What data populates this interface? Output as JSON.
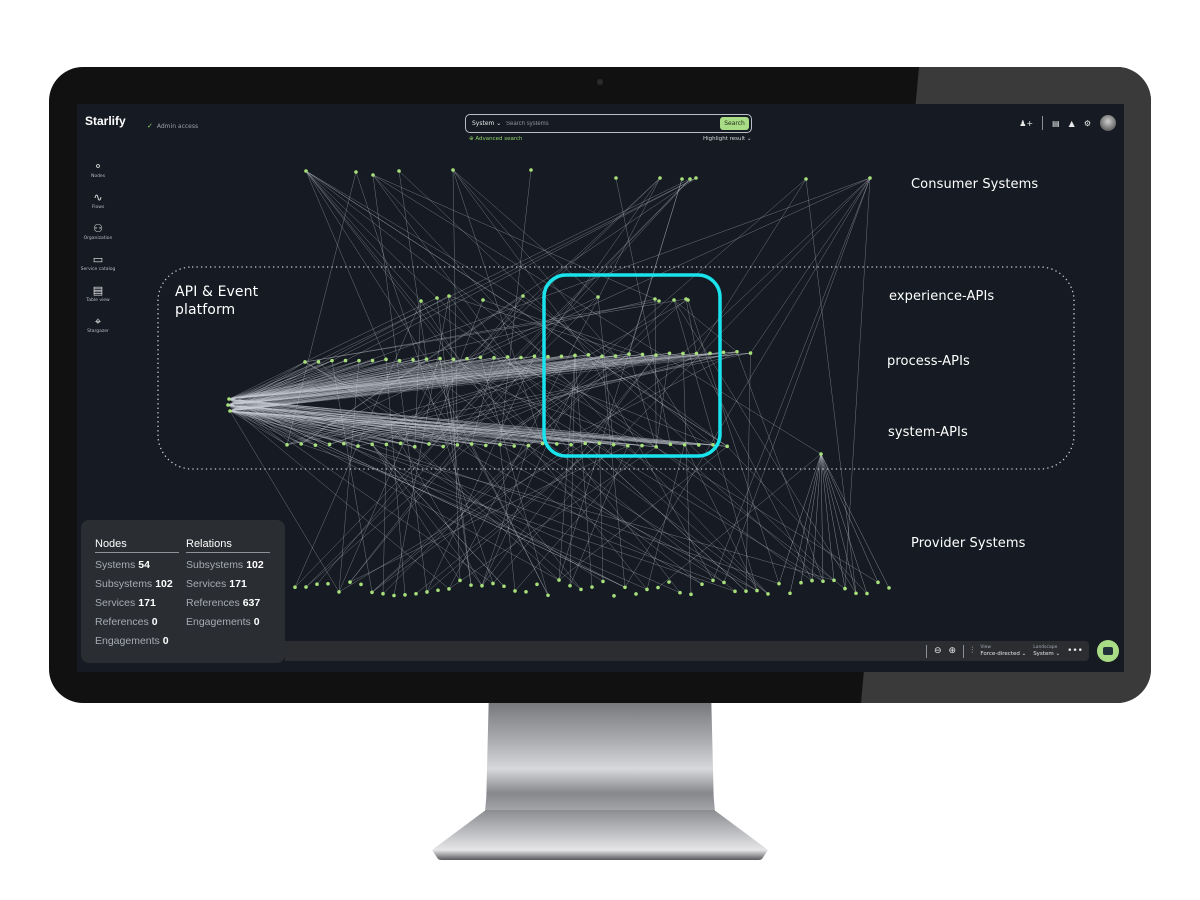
{
  "app": {
    "brand": "Starlify",
    "admin_label": "Admin access"
  },
  "search": {
    "scope": "System ⌄",
    "placeholder": "Search systems",
    "button": "Search",
    "advanced": "⊕ Advanced search",
    "highlight": "Highlight result ⌄"
  },
  "topbar_icons": [
    "add-user-icon",
    "catalog-icon",
    "bell-icon",
    "gear-icon",
    "avatar"
  ],
  "sidebar": {
    "items": [
      {
        "label": "Nodes",
        "icon": "nodes-icon",
        "glyph": "⚬"
      },
      {
        "label": "Flows",
        "icon": "flows-icon",
        "glyph": "∿"
      },
      {
        "label": "Organization",
        "icon": "organization-icon",
        "glyph": "⚇"
      },
      {
        "label": "Service catalog",
        "icon": "book-icon",
        "glyph": "▭"
      },
      {
        "label": "Table view",
        "icon": "table-icon",
        "glyph": "▤"
      },
      {
        "label": "Stargazer",
        "icon": "telescope-icon",
        "glyph": "⌖"
      }
    ]
  },
  "annotations": {
    "consumer": "Consumer Systems",
    "platform_line1": "API & Event",
    "platform_line2": "platform",
    "experience": "experience-APIs",
    "process": "process-APIs",
    "system": "system-APIs",
    "provider": "Provider Systems"
  },
  "colors": {
    "node": "#a8e07a",
    "edge": "#c9ced6",
    "highlight": "#19e3ec",
    "accent": "#a8dd86"
  },
  "stats": {
    "nodes_header": "Nodes",
    "relations_header": "Relations",
    "nodes": [
      {
        "label": "Systems",
        "value": "54"
      },
      {
        "label": "Subsystems",
        "value": "102"
      },
      {
        "label": "Services",
        "value": "171"
      },
      {
        "label": "References",
        "value": "0"
      },
      {
        "label": "Engagements",
        "value": "0"
      }
    ],
    "relations": [
      {
        "label": "Subsystems",
        "value": "102"
      },
      {
        "label": "Services",
        "value": "171"
      },
      {
        "label": "References",
        "value": "637"
      },
      {
        "label": "Engagements",
        "value": "0"
      }
    ]
  },
  "bottombar": {
    "view_label": "View",
    "view_value": "Force-directed ⌄",
    "landscape_label": "Landscape",
    "landscape_value": "System ⌄",
    "more": "•••",
    "zoom_out": "⊖",
    "zoom_in": "⊕",
    "filter": "⫶"
  }
}
